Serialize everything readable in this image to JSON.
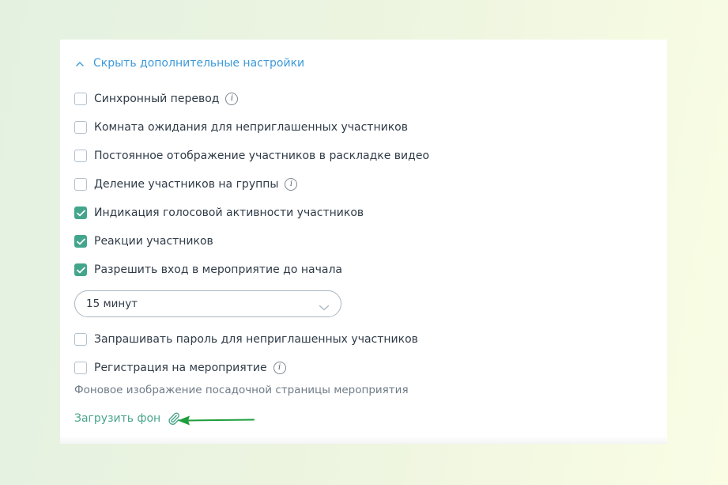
{
  "advanced": {
    "toggle_label": "Скрыть дополнительные настройки",
    "options": [
      {
        "label": "Синхронный перевод",
        "checked": false,
        "info": true
      },
      {
        "label": "Комната ожидания для неприглашенных участников",
        "checked": false,
        "info": false
      },
      {
        "label": "Постоянное отображение участников в раскладке видео",
        "checked": false,
        "info": false
      },
      {
        "label": "Деление участников на группы",
        "checked": false,
        "info": true
      },
      {
        "label": "Индикация голосовой активности участников",
        "checked": true,
        "info": false
      },
      {
        "label": "Реакции участников",
        "checked": true,
        "info": false
      },
      {
        "label": "Разрешить вход в мероприятие до начала",
        "checked": true,
        "info": false
      },
      {
        "label": "Запрашивать пароль для неприглашенных участников",
        "checked": false,
        "info": false
      },
      {
        "label": "Регистрация на мероприятие",
        "checked": false,
        "info": true
      }
    ],
    "early_entry_select": {
      "value": "15 минут"
    },
    "background": {
      "title": "Фоновое изображение посадочной страницы мероприятия",
      "upload_label": "Загрузить фон"
    }
  },
  "colors": {
    "accent_link": "#3d9ad9",
    "check_green": "#43a58c",
    "upload_green": "#4aa58a",
    "annotation_arrow": "#1e9e3c"
  },
  "icons": {
    "info": "info-icon",
    "chevron_up": "chevron-up-icon",
    "chevron_down": "chevron-down-icon",
    "paperclip": "paperclip-icon",
    "arrow": "arrow-left-icon"
  }
}
